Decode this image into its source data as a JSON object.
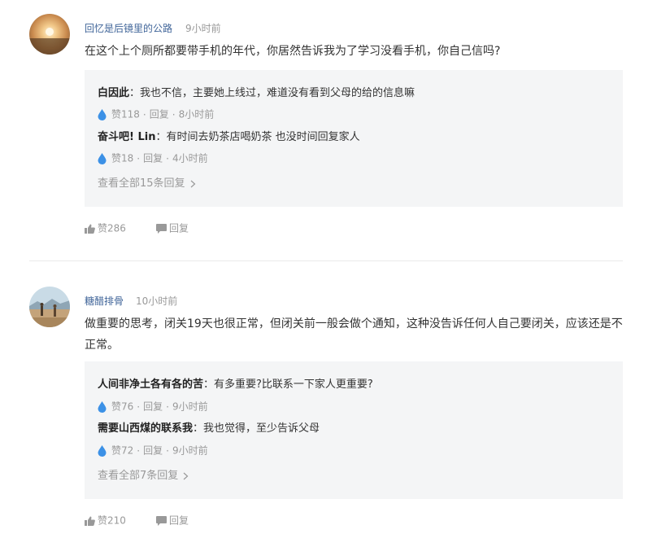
{
  "colors": {
    "author": "#406599",
    "meta": "#999999",
    "like_drop": "#3c91e6",
    "reply_bg": "#f4f5f6"
  },
  "comments": [
    {
      "author": "回忆是后镜里的公路",
      "time": "9小时前",
      "content": "在这个上个厕所都要带手机的年代，你居然告诉我为了学习没看手机，你自己信吗?",
      "avatar_icon": "sunset-avatar",
      "replies": [
        {
          "name": "白因此",
          "sep": "：",
          "text": "我也不信，主要她上线过，难道没有看到父母的给的信息嘛",
          "likes": "赞118",
          "reply_label": "回复",
          "time": "8小时前"
        },
        {
          "name": "奋斗吧! Lin",
          "sep": "：",
          "text": "有时间去奶茶店喝奶茶 也没时间回复家人",
          "likes": "赞18",
          "reply_label": "回复",
          "time": "4小时前"
        }
      ],
      "view_all": "查看全部15条回复",
      "like_count": "赞286",
      "reply_label": "回复"
    },
    {
      "author": "糖醋排骨",
      "time": "10小时前",
      "content": "做重要的思考，闭关19天也很正常，但闭关前一般会做个通知，这种没告诉任何人自己要闭关，应该还是不正常。",
      "avatar_icon": "landscape-avatar",
      "replies": [
        {
          "name": "人间非净土各有各的苦",
          "sep": "：",
          "text": "有多重要?比联系一下家人更重要?",
          "likes": "赞76",
          "reply_label": "回复",
          "time": "9小时前"
        },
        {
          "name": "需要山西煤的联系我",
          "sep": "：",
          "text": "我也觉得，至少告诉父母",
          "likes": "赞72",
          "reply_label": "回复",
          "time": "9小时前"
        }
      ],
      "view_all": "查看全部7条回复",
      "like_count": "赞210",
      "reply_label": "回复"
    }
  ]
}
